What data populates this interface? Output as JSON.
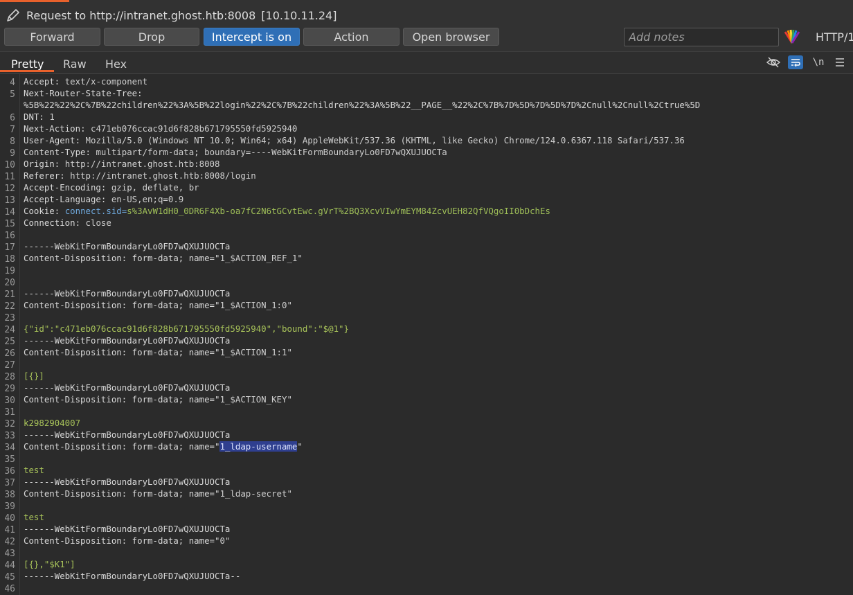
{
  "window": {
    "title": "Request to http://intranet.ghost.htb:8008",
    "ip": "[10.10.11.24]"
  },
  "toolbar": {
    "forward": "Forward",
    "drop": "Drop",
    "intercept": "Intercept is on",
    "action": "Action",
    "open_browser": "Open browser",
    "notes_placeholder": "Add notes",
    "protocol": "HTTP/1"
  },
  "tabs": [
    "Pretty",
    "Raw",
    "Hex"
  ],
  "editor_tools": {
    "newline": "\\n"
  },
  "request_lines": [
    {
      "n": "4",
      "k": "Accept",
      "v": "text/x-component"
    },
    {
      "n": "5",
      "k": "Next-Router-State-Tree",
      "v": ""
    },
    {
      "n": "",
      "t": "%5B%22%22%2C%7B%22children%22%3A%5B%22login%22%2C%7B%22children%22%3A%5B%22__PAGE__%22%2C%7B%7D%5D%7D%5D%7D%2Cnull%2Cnull%2Ctrue%5D"
    },
    {
      "n": "6",
      "k": "DNT",
      "v": "1"
    },
    {
      "n": "7",
      "k": "Next-Action",
      "v": "c471eb076ccac91d6f828b671795550fd5925940"
    },
    {
      "n": "8",
      "k": "User-Agent",
      "v": "Mozilla/5.0 (Windows NT 10.0; Win64; x64) AppleWebKit/537.36 (KHTML, like Gecko) Chrome/124.0.6367.118 Safari/537.36"
    },
    {
      "n": "9",
      "k": "Content-Type",
      "v": "multipart/form-data; boundary=----WebKitFormBoundaryLo0FD7wQXUJUOCTa"
    },
    {
      "n": "10",
      "k": "Origin",
      "v": "http://intranet.ghost.htb:8008"
    },
    {
      "n": "11",
      "k": "Referer",
      "v": "http://intranet.ghost.htb:8008/login"
    },
    {
      "n": "12",
      "k": "Accept-Encoding",
      "v": "gzip, deflate, br"
    },
    {
      "n": "13",
      "k": "Accept-Language",
      "v": "en-US,en;q=0.9"
    },
    {
      "n": "14",
      "k": "Cookie",
      "ck": "connect.sid",
      "cv": "s%3AvW1dH0_0DR6F4Xb-oa7fC2N6tGCvtEwc.gVrT%2BQ3XcvVIwYmEYM84ZcvUEH82QfVQgoII0bDchEs"
    },
    {
      "n": "15",
      "k": "Connection",
      "v": "close"
    },
    {
      "n": "16",
      "t": ""
    },
    {
      "n": "17",
      "t": "------WebKitFormBoundaryLo0FD7wQXUJUOCTa"
    },
    {
      "n": "18",
      "d": "Content-Disposition: form-data; name=\"",
      "dn": "1_$ACTION_REF_1",
      "dq": "\""
    },
    {
      "n": "19",
      "t": ""
    },
    {
      "n": "20",
      "t": ""
    },
    {
      "n": "21",
      "t": "------WebKitFormBoundaryLo0FD7wQXUJUOCTa"
    },
    {
      "n": "22",
      "d": "Content-Disposition: form-data; name=\"",
      "dn": "1_$ACTION_1:0",
      "dq": "\""
    },
    {
      "n": "23",
      "t": ""
    },
    {
      "n": "24",
      "b": "{\"id\":\"c471eb076ccac91d6f828b671795550fd5925940\",\"bound\":\"$@1\"}"
    },
    {
      "n": "25",
      "t": "------WebKitFormBoundaryLo0FD7wQXUJUOCTa"
    },
    {
      "n": "26",
      "d": "Content-Disposition: form-data; name=\"",
      "dn": "1_$ACTION_1:1",
      "dq": "\""
    },
    {
      "n": "27",
      "t": ""
    },
    {
      "n": "28",
      "b": "[{}]"
    },
    {
      "n": "29",
      "t": "------WebKitFormBoundaryLo0FD7wQXUJUOCTa"
    },
    {
      "n": "30",
      "d": "Content-Disposition: form-data; name=\"",
      "dn": "1_$ACTION_KEY",
      "dq": "\""
    },
    {
      "n": "31",
      "t": ""
    },
    {
      "n": "32",
      "b": "k2982904007"
    },
    {
      "n": "33",
      "t": "------WebKitFormBoundaryLo0FD7wQXUJUOCTa"
    },
    {
      "n": "34",
      "d": "Content-Disposition: form-data; name=\"",
      "dn": "1_ldap-username",
      "dq": "\"",
      "sel": true
    },
    {
      "n": "35",
      "t": ""
    },
    {
      "n": "36",
      "b": "test"
    },
    {
      "n": "37",
      "t": "------WebKitFormBoundaryLo0FD7wQXUJUOCTa"
    },
    {
      "n": "38",
      "d": "Content-Disposition: form-data; name=\"",
      "dn": "1_ldap-secret",
      "dq": "\""
    },
    {
      "n": "39",
      "t": ""
    },
    {
      "n": "40",
      "b": "test"
    },
    {
      "n": "41",
      "t": "------WebKitFormBoundaryLo0FD7wQXUJUOCTa"
    },
    {
      "n": "42",
      "d": "Content-Disposition: form-data; name=\"",
      "dn": "0",
      "dq": "\""
    },
    {
      "n": "43",
      "t": ""
    },
    {
      "n": "44",
      "b": "[{},\"$K1\"]"
    },
    {
      "n": "45",
      "t": "------WebKitFormBoundaryLo0FD7wQXUJUOCTa--"
    },
    {
      "n": "46",
      "t": ""
    }
  ]
}
